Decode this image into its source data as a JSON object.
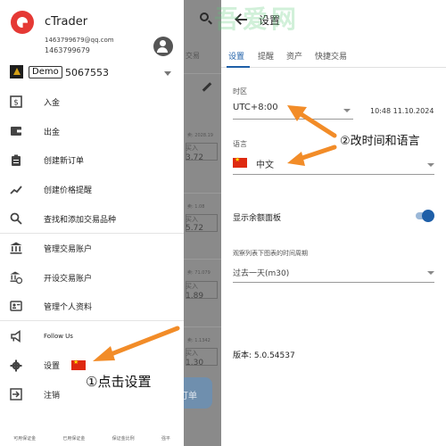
{
  "watermark": "吾爱网",
  "drawer": {
    "app_name": "cTrader",
    "email": "1463799679@qq.com",
    "phone": "1463799679",
    "account_badge": "Demo",
    "account_number": "5067553",
    "items": [
      {
        "label": "入金",
        "icon": "deposit-icon"
      },
      {
        "label": "出金",
        "icon": "wallet-icon"
      },
      {
        "label": "创建新订单",
        "icon": "clipboard-icon"
      },
      {
        "label": "创建价格提醒",
        "icon": "trend-icon"
      },
      {
        "label": "查找和添加交易品种",
        "icon": "search-icon"
      },
      {
        "label": "管理交易账户",
        "icon": "bank-icon"
      },
      {
        "label": "开设交易账户",
        "icon": "bank-plus-icon"
      },
      {
        "label": "管理个人资料",
        "icon": "profile-icon"
      },
      {
        "label": "Follow Us",
        "icon": "megaphone-icon"
      },
      {
        "label": "设置",
        "icon": "gear-icon"
      },
      {
        "label": "注销",
        "icon": "logout-icon"
      }
    ],
    "footer": [
      "可用保证金",
      "已用保证金",
      "保证金比例",
      "强平"
    ]
  },
  "background": {
    "header_text": "交易",
    "prices": [
      {
        "small": "卖: 2028.19",
        "side": "买入",
        "price": "3.72"
      },
      {
        "small": "卖: 1.08",
        "side": "买入",
        "price": "5.72"
      },
      {
        "small": "卖: 71.079",
        "side": "买入",
        "price": "1.89"
      },
      {
        "small": "卖: 1.1342",
        "side": "买入",
        "price": "1.30"
      }
    ],
    "order_button": "订单"
  },
  "settings": {
    "title": "设置",
    "tabs": [
      "设置",
      "提醒",
      "资产",
      "快捷交易"
    ],
    "timezone_label": "时区",
    "timezone_value": "UTC+8:00",
    "datetime": "10:48 11.10.2024",
    "language_label": "语言",
    "language_value": "中文",
    "balance_toggle_label": "显示余额面板",
    "balance_toggle_on": true,
    "period_label": "观察列表下图表的时间周期",
    "period_value": "过去一天(m30)",
    "version": "版本: 5.0.54537"
  },
  "annotations": {
    "step1": "①点击设置",
    "step2": "②改时间和语言"
  },
  "colors": {
    "accent": "#1e5fa8",
    "brand_red": "#e53935",
    "arrow_orange": "#f28c28"
  }
}
